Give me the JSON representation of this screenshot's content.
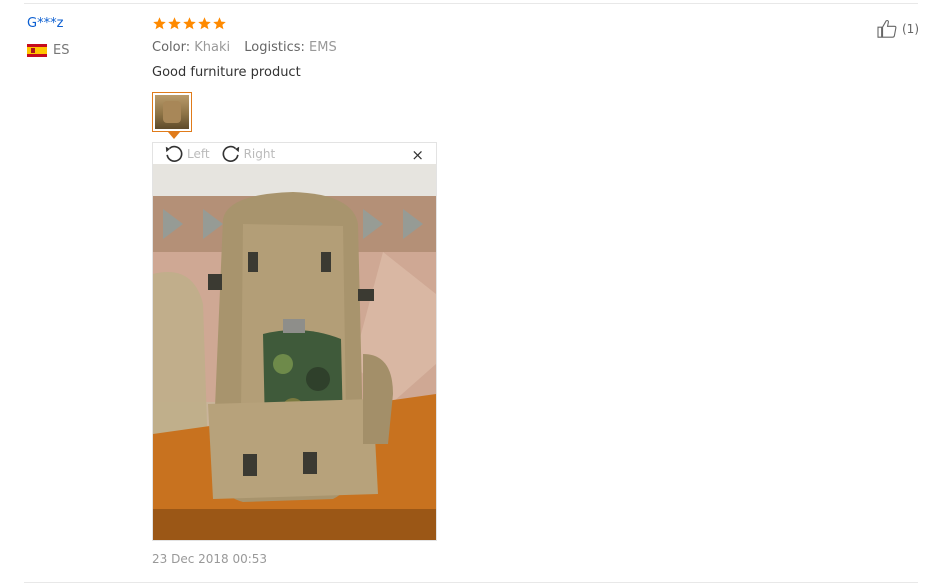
{
  "review": {
    "user_name": "G***z",
    "country_code": "ES",
    "rating": 5,
    "attributes": [
      {
        "key": "Color:",
        "value": "Khaki"
      },
      {
        "key": "Logistics:",
        "value": "EMS"
      }
    ],
    "feedback": "Good furniture product",
    "date": "23 Dec 2018 00:53",
    "likes": "(1)"
  },
  "viewer": {
    "rotate_left_label": "Left",
    "rotate_right_label": "Right",
    "close_label": "×"
  }
}
